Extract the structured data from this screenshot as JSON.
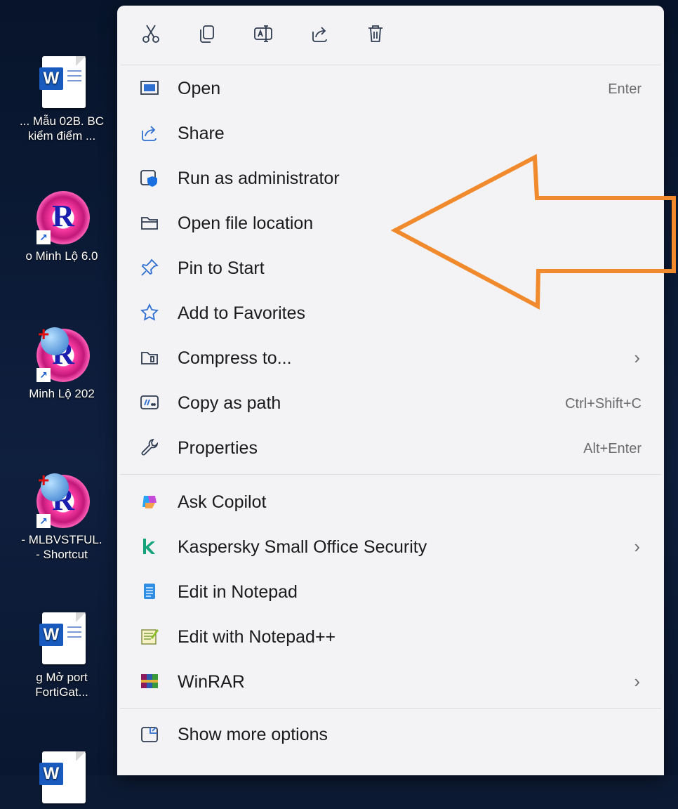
{
  "desktop": {
    "icons": [
      {
        "label": "...  Mẫu 02B. BC\nkiểm điểm ...",
        "type": "word"
      },
      {
        "label": "o   Minh Lộ 6.0",
        "type": "app"
      },
      {
        "label": "Minh Lộ 202",
        "type": "app-globe"
      },
      {
        "label": "-  MLBVSTFUL.\n- Shortcut",
        "type": "app-globe"
      },
      {
        "label": "g     Mở port\nFortiGat...",
        "type": "word"
      }
    ]
  },
  "toolbar": {
    "buttons": [
      {
        "name": "cut",
        "icon": "scissors-icon"
      },
      {
        "name": "copy",
        "icon": "copy-icon"
      },
      {
        "name": "rename",
        "icon": "rename-icon"
      },
      {
        "name": "share",
        "icon": "share-icon"
      },
      {
        "name": "delete",
        "icon": "trash-icon"
      }
    ]
  },
  "menu": {
    "group1": [
      {
        "label": "Open",
        "shortcut": "Enter",
        "icon": "open-window-icon"
      },
      {
        "label": "Share",
        "shortcut": "",
        "icon": "share-icon"
      },
      {
        "label": "Run as administrator",
        "shortcut": "",
        "icon": "shield-admin-icon"
      },
      {
        "label": "Open file location",
        "shortcut": "",
        "icon": "folder-icon"
      },
      {
        "label": "Pin to Start",
        "shortcut": "",
        "icon": "pin-icon"
      },
      {
        "label": "Add to Favorites",
        "shortcut": "",
        "icon": "star-icon"
      },
      {
        "label": "Compress to...",
        "shortcut": "",
        "icon": "zip-folder-icon",
        "submenu": true
      },
      {
        "label": "Copy as path",
        "shortcut": "Ctrl+Shift+C",
        "icon": "path-icon"
      },
      {
        "label": "Properties",
        "shortcut": "Alt+Enter",
        "icon": "wrench-icon"
      }
    ],
    "group2": [
      {
        "label": "Ask Copilot",
        "icon": "copilot-icon"
      },
      {
        "label": "Kaspersky Small Office Security",
        "icon": "kaspersky-icon",
        "submenu": true
      },
      {
        "label": "Edit in Notepad",
        "icon": "notepad-icon"
      },
      {
        "label": "Edit with Notepad++",
        "icon": "notepadpp-icon"
      },
      {
        "label": "WinRAR",
        "icon": "winrar-icon",
        "submenu": true
      }
    ],
    "group3": [
      {
        "label": "Show more options",
        "icon": "more-options-icon"
      }
    ],
    "chevron": "›"
  },
  "colors": {
    "annotation_arrow": "#f08a2c",
    "menu_bg": "#f3f3f6",
    "accent": "#0067c0"
  }
}
